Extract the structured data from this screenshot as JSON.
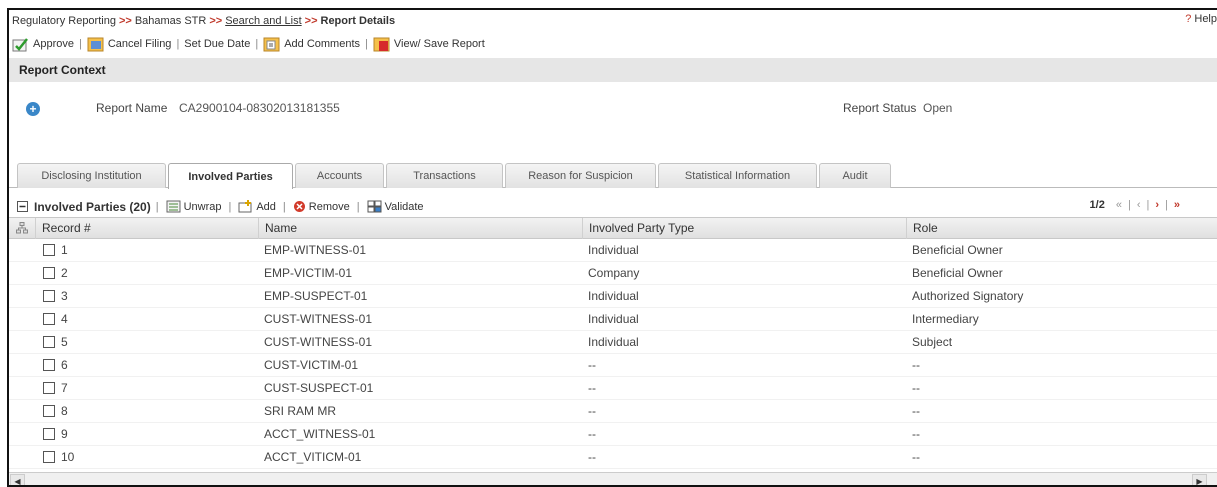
{
  "breadcrumb": {
    "items": [
      "Regulatory Reporting",
      "Bahamas STR",
      "Search and List",
      "Report Details"
    ],
    "separator": ">>"
  },
  "help": {
    "icon": "?",
    "label": "Help"
  },
  "actions": [
    {
      "label": "Approve",
      "icon": "approve-icon"
    },
    {
      "label": "Cancel Filing",
      "icon": "cancel-filing-icon"
    },
    {
      "label": "Set Due Date",
      "icon": ""
    },
    {
      "label": "Add Comments",
      "icon": "add-comments-icon"
    },
    {
      "label": "View/ Save Report",
      "icon": "pdf-report-icon"
    }
  ],
  "context": {
    "title": "Report Context",
    "report_name_label": "Report Name",
    "report_name_value": "CA2900104-08302013181355",
    "report_status_label": "Report Status",
    "report_status_value": "Open"
  },
  "tabs": [
    "Disclosing Institution",
    "Involved Parties",
    "Accounts",
    "Transactions",
    "Reason for Suspicion",
    "Statistical Information",
    "Audit"
  ],
  "active_tab": "Involved Parties",
  "grid": {
    "title": "Involved Parties (20)",
    "tools": [
      "Unwrap",
      "Add",
      "Remove",
      "Validate"
    ],
    "pager": "1/2",
    "columns": [
      "Record #",
      "Name",
      "Involved Party Type",
      "Role"
    ],
    "rows": [
      [
        "1",
        "EMP-WITNESS-01",
        "Individual",
        "Beneficial Owner"
      ],
      [
        "2",
        "EMP-VICTIM-01",
        "Company",
        "Beneficial Owner"
      ],
      [
        "3",
        "EMP-SUSPECT-01",
        "Individual",
        "Authorized Signatory"
      ],
      [
        "4",
        "CUST-WITNESS-01",
        "Individual",
        "Intermediary"
      ],
      [
        "5",
        "CUST-WITNESS-01",
        "Individual",
        "Subject"
      ],
      [
        "6",
        "CUST-VICTIM-01",
        "--",
        "--"
      ],
      [
        "7",
        "CUST-SUSPECT-01",
        "--",
        "--"
      ],
      [
        "8",
        "SRI RAM MR",
        "--",
        "--"
      ],
      [
        "9",
        "ACCT_WITNESS-01",
        "--",
        "--"
      ],
      [
        "10",
        "ACCT_VITICM-01",
        "--",
        "--"
      ]
    ]
  },
  "colors": {
    "link_red": "#c0392b",
    "header_gray": "#e6e6e6",
    "accent_blue": "#3a87c8"
  }
}
